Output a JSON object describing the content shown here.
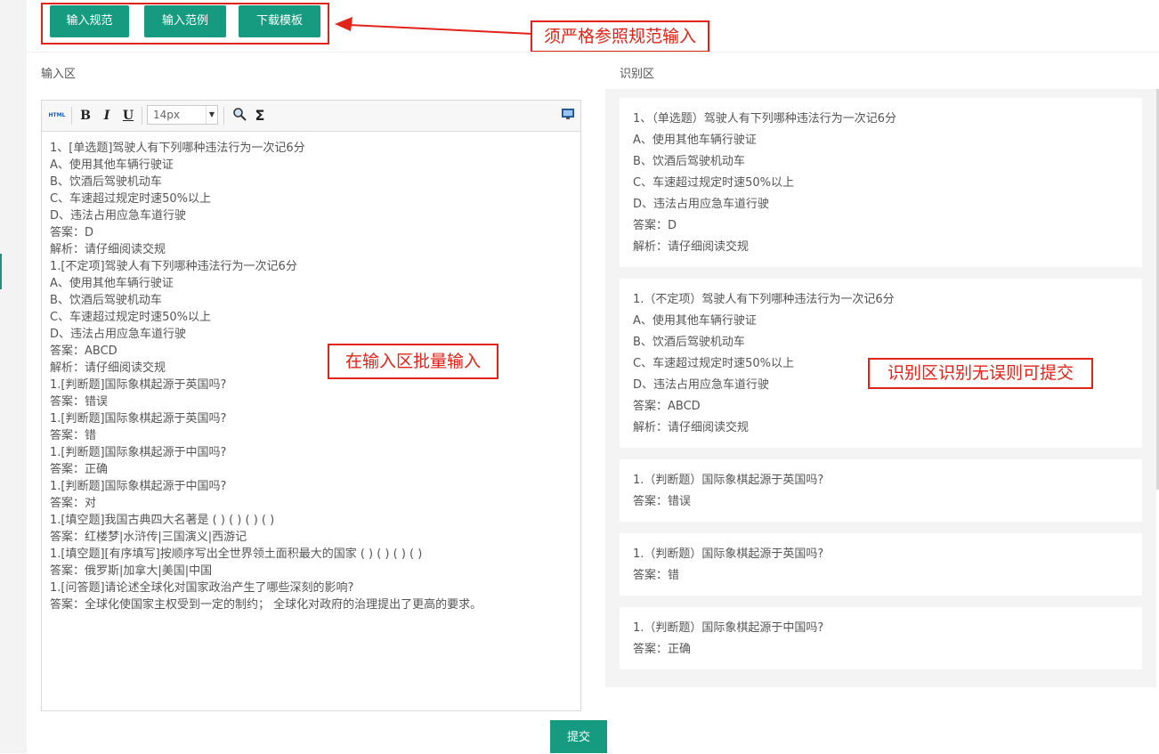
{
  "toolbar_buttons": {
    "input_spec": "输入规范",
    "input_example": "输入范例",
    "download_template": "下载模板"
  },
  "callouts": {
    "strict_spec": "须严格参照规范输入",
    "batch_input": "在输入区批量输入",
    "submit_if_correct": "识别区识别无误则可提交"
  },
  "input_area": {
    "label": "输入区",
    "editor": {
      "html_label": "HTML",
      "bold_label": "B",
      "italic_label": "I",
      "underline_label": "U",
      "font_size": "14px",
      "lines": [
        "1、[单选题]驾驶人有下列哪种违法行为一次记6分",
        "A、使用其他车辆行驶证",
        "B、饮酒后驾驶机动车",
        "C、车速超过规定时速50%以上",
        "D、违法占用应急车道行驶",
        "答案：D",
        "解析：请仔细阅读交规",
        "1.[不定项]驾驶人有下列哪种违法行为一次记6分",
        "A、使用其他车辆行驶证",
        "B、饮酒后驾驶机动车",
        "C、车速超过规定时速50%以上",
        "D、违法占用应急车道行驶",
        "答案：ABCD",
        "解析：请仔细阅读交规",
        "1.[判断题]国际象棋起源于英国吗?",
        "答案：错误",
        "1.[判断题]国际象棋起源于英国吗?",
        "答案：错",
        "1.[判断题]国际象棋起源于中国吗?",
        "答案：正确",
        "1.[判断题]国际象棋起源于中国吗?",
        "答案：对",
        "1.[填空题]我国古典四大名著是 ( ) ( ) ( ) ( )",
        "答案：红楼梦|水浒传|三国演义|西游记",
        "1.[填空题][有序填写]按顺序写出全世界领土面积最大的国家 ( ) ( ) ( ) ( )",
        "答案：俄罗斯|加拿大|美国|中国",
        "1.[问答题]请论述全球化对国家政治产生了哪些深刻的影响?",
        "答案：全球化使国家主权受到一定的制约；  全球化对政府的治理提出了更高的要求。"
      ]
    }
  },
  "recognition_area": {
    "label": "识别区",
    "cards": [
      {
        "lines": [
          "1、（单选题）驾驶人有下列哪种违法行为一次记6分",
          "A、使用其他车辆行驶证",
          "B、饮酒后驾驶机动车",
          "C、车速超过规定时速50%以上",
          "D、违法占用应急车道行驶",
          "答案：D",
          "解析：请仔细阅读交规"
        ]
      },
      {
        "lines": [
          "1.（不定项）驾驶人有下列哪种违法行为一次记6分",
          "A、使用其他车辆行驶证",
          "B、饮酒后驾驶机动车",
          "C、车速超过规定时速50%以上",
          "D、违法占用应急车道行驶",
          "答案：ABCD",
          "解析：请仔细阅读交规"
        ]
      },
      {
        "lines": [
          "1.（判断题）国际象棋起源于英国吗?",
          "答案：错误"
        ]
      },
      {
        "lines": [
          "1.（判断题）国际象棋起源于英国吗?",
          "答案：错"
        ]
      },
      {
        "lines": [
          "1.（判断题）国际象棋起源于中国吗?",
          "答案：正确"
        ]
      }
    ]
  },
  "submit_label": "提交",
  "colors": {
    "accent": "#169b81",
    "callout": "#e2231a"
  }
}
